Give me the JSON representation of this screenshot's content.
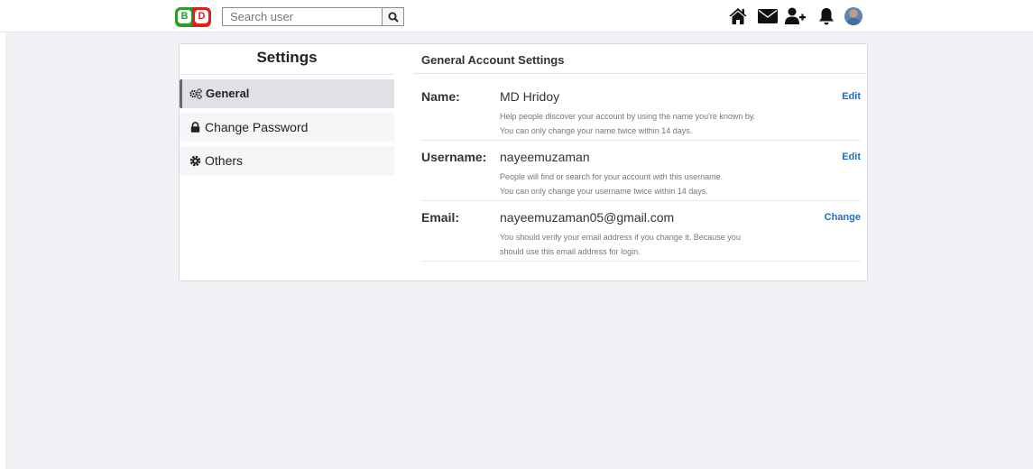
{
  "logo": {
    "left_letter": "B",
    "right_letter": "D",
    "colors": {
      "left": "#2a9d2a",
      "right": "#e0201c"
    }
  },
  "search": {
    "placeholder": "Search user",
    "value": "",
    "button_icon": "search-icon"
  },
  "nav_icons": [
    "home-icon",
    "envelope-icon",
    "add-user-icon",
    "bell-icon",
    "avatar"
  ],
  "sidebar": {
    "title": "Settings",
    "items": [
      {
        "label": "General",
        "icon": "gears-icon",
        "active": true
      },
      {
        "label": "Change Password",
        "icon": "lock-icon",
        "active": false
      },
      {
        "label": "Others",
        "icon": "gear-icon",
        "active": false
      }
    ]
  },
  "main": {
    "title": "General Account Settings",
    "rows": [
      {
        "label": "Name:",
        "value": "MD Hridoy",
        "help_1": "Help people discover your account by using the name you're known by.",
        "help_2": "You can only change your name twice within 14 days.",
        "action": "Edit"
      },
      {
        "label": "Username:",
        "value": "nayeemuzaman",
        "help_1": "People will find or search for your account with this username.",
        "help_2": "You can only change your username twice within 14 days.",
        "action": "Edit"
      },
      {
        "label": "Email:",
        "value": "nayeemuzaman05@gmail.com",
        "help_1": "You should verify your email address if you change it. Because you",
        "help_2": "should use this email address for login.",
        "action": "Change"
      }
    ]
  },
  "colors": {
    "accent": "#1f6fc6",
    "page_bg": "#f0f1f5",
    "active_item_bg": "#dfe1e6"
  }
}
